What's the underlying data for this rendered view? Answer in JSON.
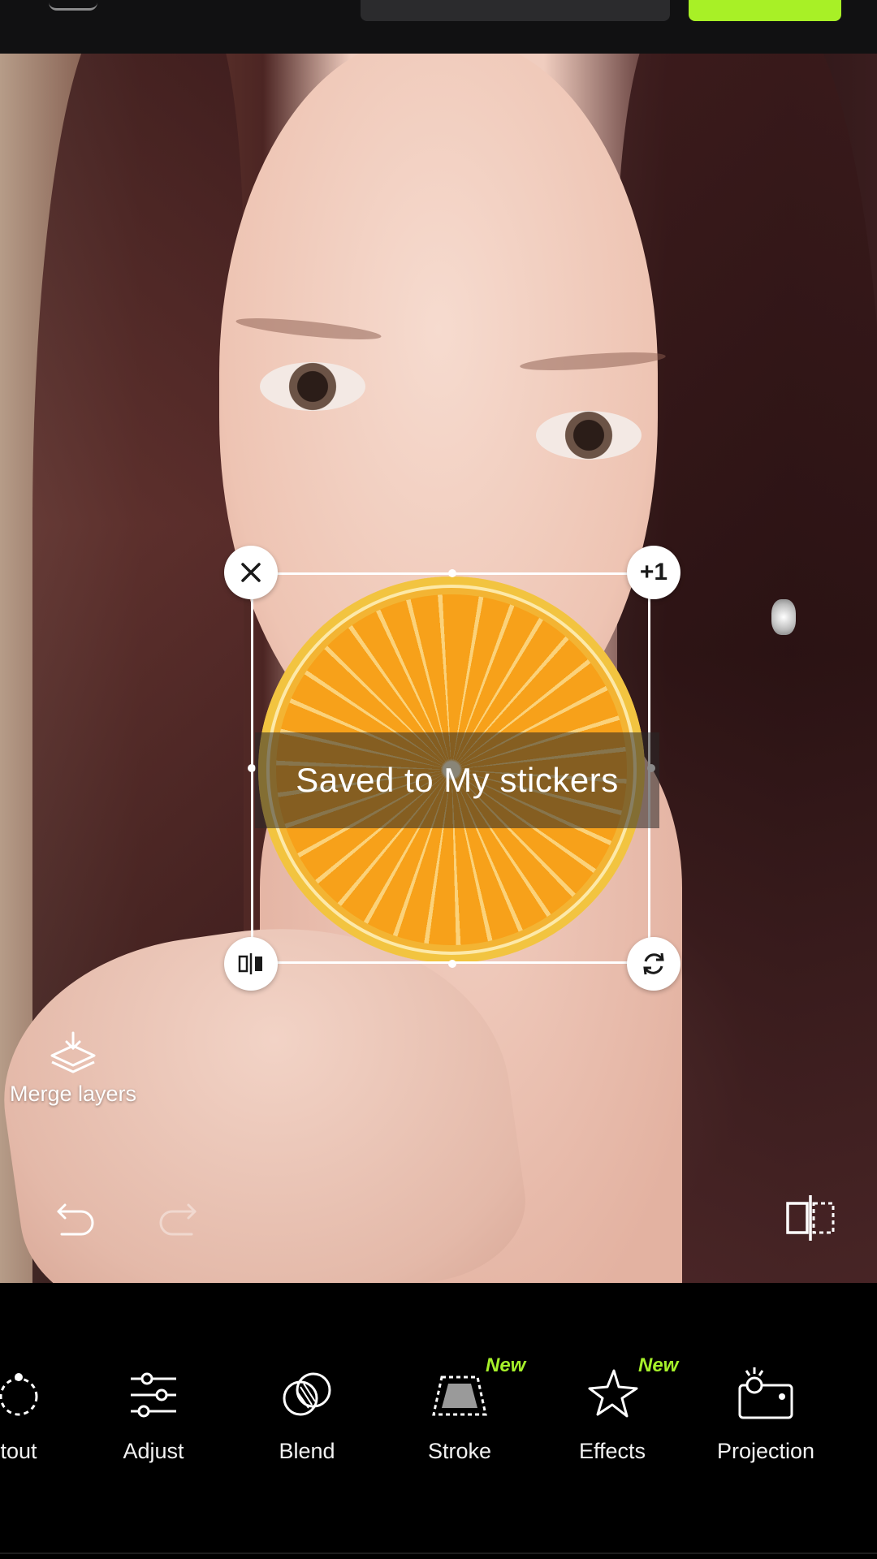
{
  "toast": {
    "text": "Saved to My stickers"
  },
  "sticker": {
    "duplicate_label": "+1"
  },
  "side_actions": {
    "merge_layers": "Merge layers"
  },
  "toolbar": {
    "items": [
      {
        "label": "tout",
        "icon": "cutout-icon"
      },
      {
        "label": "Adjust",
        "icon": "adjust-sliders-icon"
      },
      {
        "label": "Blend",
        "icon": "blend-icon"
      },
      {
        "label": "Stroke",
        "icon": "stroke-icon",
        "badge": "New"
      },
      {
        "label": "Effects",
        "icon": "effects-star-icon",
        "badge": "New"
      },
      {
        "label": "Projection",
        "icon": "projection-icon"
      }
    ]
  },
  "colors": {
    "accent": "#a8f026",
    "badge": "#a6f12a"
  }
}
